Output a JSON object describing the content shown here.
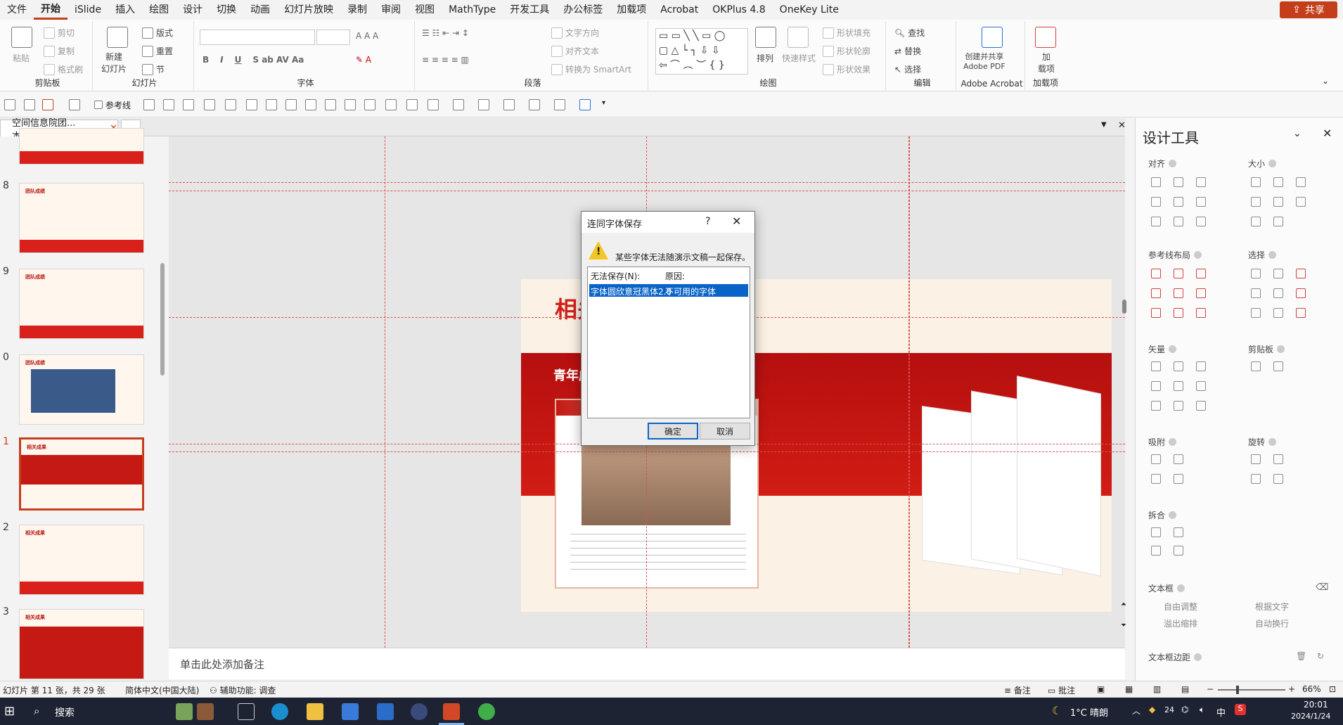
{
  "menu": {
    "items": [
      "文件",
      "开始",
      "iSlide",
      "插入",
      "绘图",
      "设计",
      "切换",
      "动画",
      "幻灯片放映",
      "录制",
      "审阅",
      "视图",
      "MathType",
      "开发工具",
      "办公标签",
      "加载项",
      "Acrobat",
      "OKPlus 4.8",
      "OneKey Lite"
    ],
    "active": "开始",
    "share": "共享"
  },
  "ribbon": {
    "clipboard": {
      "label": "剪贴板",
      "paste": "粘贴",
      "cut": "剪切",
      "copy": "复制",
      "format": "格式刷"
    },
    "slides": {
      "label": "幻灯片",
      "new_slide": "新建\n幻灯片",
      "layout": "版式",
      "reset": "重置",
      "section": "节"
    },
    "font": {
      "label": "字体"
    },
    "paragraph": {
      "label": "段落",
      "text_direction": "文字方向",
      "align_text": "对齐文本",
      "smartart": "转换为 SmartArt"
    },
    "drawing": {
      "label": "绘图",
      "arrange": "排列",
      "quick_styles": "快速样式",
      "fill": "形状填充",
      "outline": "形状轮廓",
      "effect": "形状效果"
    },
    "editing": {
      "label": "编辑",
      "find": "查找",
      "replace": "替换",
      "select": "选择"
    },
    "acrobat": {
      "label": "Adobe Acrobat",
      "create": "创建并共享\nAdobe PDF"
    },
    "addins": {
      "label": "加载项",
      "btn": "加\n载项"
    }
  },
  "qat": {
    "guides": "参考线"
  },
  "tab": {
    "doc_name": "空间信息院团...本.pptx"
  },
  "thumbnails": [
    {
      "num": "",
      "title": ""
    },
    {
      "num": "8",
      "title": "团队成绩"
    },
    {
      "num": "9",
      "title": "团队成绩"
    },
    {
      "num": "0",
      "title": "团队成绩"
    },
    {
      "num": "1",
      "title": "相关成果"
    },
    {
      "num": "2",
      "title": "相关成果"
    },
    {
      "num": "3",
      "title": "相关成果"
    }
  ],
  "slide": {
    "title": "相关成果",
    "subtitle": "青年成长成才沙龙活动嘉宾"
  },
  "notes": {
    "placeholder": "单击此处添加备注"
  },
  "panel": {
    "title": "设计工具",
    "sections": {
      "align": "对齐",
      "size": "大小",
      "guide_layout": "参考线布局",
      "select": "选择",
      "vector": "矢量",
      "clipboard": "剪贴板",
      "snap": "吸附",
      "rotate": "旋转",
      "split": "拆合",
      "textbox": "文本框",
      "textbox_margin": "文本框边距"
    },
    "textbox_options": [
      "自由调整",
      "根据文字",
      "溢出缩排",
      "自动换行"
    ]
  },
  "dialog": {
    "title": "连同字体保存",
    "help": "?",
    "message": "某些字体无法随演示文稿一起保存。",
    "col_font": "无法保存(N):",
    "col_reason": "原因:",
    "row_font": "字体圆欣意冠黑体2.0",
    "row_reason": "不可用的字体",
    "ok": "确定",
    "cancel": "取消"
  },
  "status": {
    "slide_info": "幻灯片 第 11 张，共 29 张",
    "language": "简体中文(中国大陆)",
    "accessibility": "辅助功能: 调查",
    "notes": "备注",
    "comments": "批注",
    "zoom": "66%"
  },
  "taskbar": {
    "search": "搜索",
    "weather": "1°C 晴朗",
    "time": "20:01",
    "date": "2024/1/24",
    "ime": "中",
    "num": "24"
  },
  "colors": {
    "accent": "#c43e1c",
    "slide_red": "#d11f1a",
    "selection": "#0a64c8"
  }
}
